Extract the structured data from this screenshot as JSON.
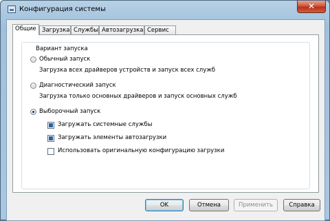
{
  "window": {
    "title": "Конфигурация системы",
    "close_glyph": "✕"
  },
  "tabs": [
    {
      "label": "Общие",
      "active": true
    },
    {
      "label": "Загрузка",
      "active": false
    },
    {
      "label": "Службы",
      "active": false
    },
    {
      "label": "Автозагрузка",
      "active": false
    },
    {
      "label": "Сервис",
      "active": false
    }
  ],
  "startup": {
    "group_title": "Вариант запуска",
    "options": [
      {
        "label": "Обычный запуск",
        "description": "Загрузка всех драйверов устройств и запуск всех служб",
        "selected": false
      },
      {
        "label": "Диагностический запуск",
        "description": "Загрузка только основных драйверов и запуск основных служб",
        "selected": false
      },
      {
        "label": "Выборочный запуск",
        "description": "",
        "selected": true
      }
    ],
    "checkboxes": [
      {
        "label": "Загружать системные службы",
        "checked": true
      },
      {
        "label": "Загружать элементы автозагрузки",
        "checked": true
      },
      {
        "label": "Использовать оригинальную конфигурацию загрузки",
        "checked": false
      }
    ]
  },
  "buttons": {
    "ok": "OK",
    "cancel": "Отмена",
    "apply": "Применить",
    "help": "Справка"
  },
  "colors": {
    "accent": "#3c7fb1",
    "close": "#c8452a"
  }
}
